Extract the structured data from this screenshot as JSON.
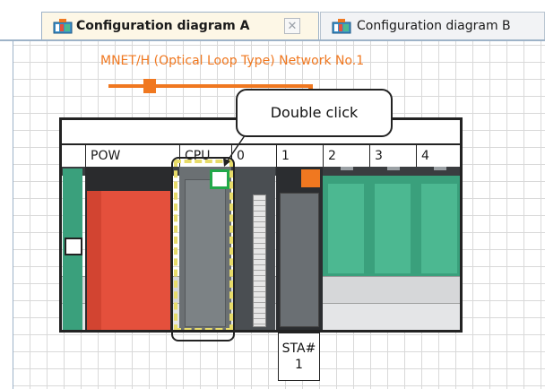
{
  "tabs": [
    {
      "label": "Configuration diagram A",
      "active": true,
      "close_symbol": "✕"
    },
    {
      "label": "Configuration diagram B",
      "active": false
    }
  ],
  "network": {
    "label": "MNET/H (Optical Loop Type) Network No.1",
    "color": "#f07820"
  },
  "slots": [
    {
      "id": "pow",
      "label": "POW"
    },
    {
      "id": "cpu",
      "label": "CPU"
    },
    {
      "id": "0",
      "label": "0"
    },
    {
      "id": "1",
      "label": "1"
    },
    {
      "id": "2",
      "label": "2"
    },
    {
      "id": "3",
      "label": "3"
    },
    {
      "id": "4",
      "label": "4"
    }
  ],
  "callout": {
    "text": "Double click"
  },
  "station": {
    "line1": "STA#",
    "line2": "1"
  },
  "colors": {
    "power_module": "#e4503c",
    "empty_slot": "#3aa07c",
    "cpu_led": "#22a84a",
    "selection": "#e8dc6a"
  }
}
